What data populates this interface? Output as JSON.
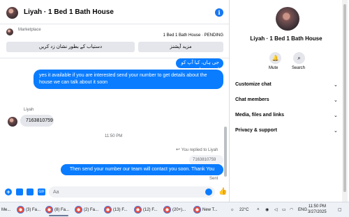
{
  "header": {
    "title": "Liyah · 1 Bed 1 Bath House",
    "info_icon": "info-icon"
  },
  "marketplace": {
    "label": "Marketplace",
    "listing_status": "1 Bed 1 Bath House · PENDING",
    "btn_mark": "دستیاب کے بطور نشان زد کریں",
    "btn_more": "مزید آپشنز"
  },
  "messages": {
    "m1": "جی ہاں، کیا آپ کو اب بھی دلچسپی ہے؟",
    "m2": "yes it available if you are interested send your number to get details about the house we can talk about it soon",
    "sender": "Liyah",
    "m3": "7163810759",
    "timestamp": "11:50 PM",
    "reply_note": "You replied to Liyah",
    "quoted": "7163810759",
    "m4": "Then send your number our team will contact you soon. Thank You",
    "sent": "Sent"
  },
  "composer": {
    "placeholder": "Aa",
    "gif_label": "GIF"
  },
  "panel": {
    "title": "Liyah · 1 Bed 1 Bath House",
    "mute_label": "Mute",
    "search_label": "Search",
    "sections": [
      "Customize chat",
      "Chat members",
      "Media, files and links",
      "Privacy & support"
    ]
  },
  "taskbar": {
    "items": [
      "Me...",
      "(3) Fa...",
      "(8) Fa...",
      "(2) Fa...",
      "(13) F...",
      "(12) F...",
      "(20+)...",
      "New T..."
    ],
    "temperature": "22°C",
    "lang": "ENG",
    "time": "11:50 PM",
    "date": "3/27/2025"
  },
  "colors": {
    "accent": "#0a7cff",
    "bubble_in": "#e4e6eb",
    "text": "#050505",
    "muted": "#65676b"
  }
}
